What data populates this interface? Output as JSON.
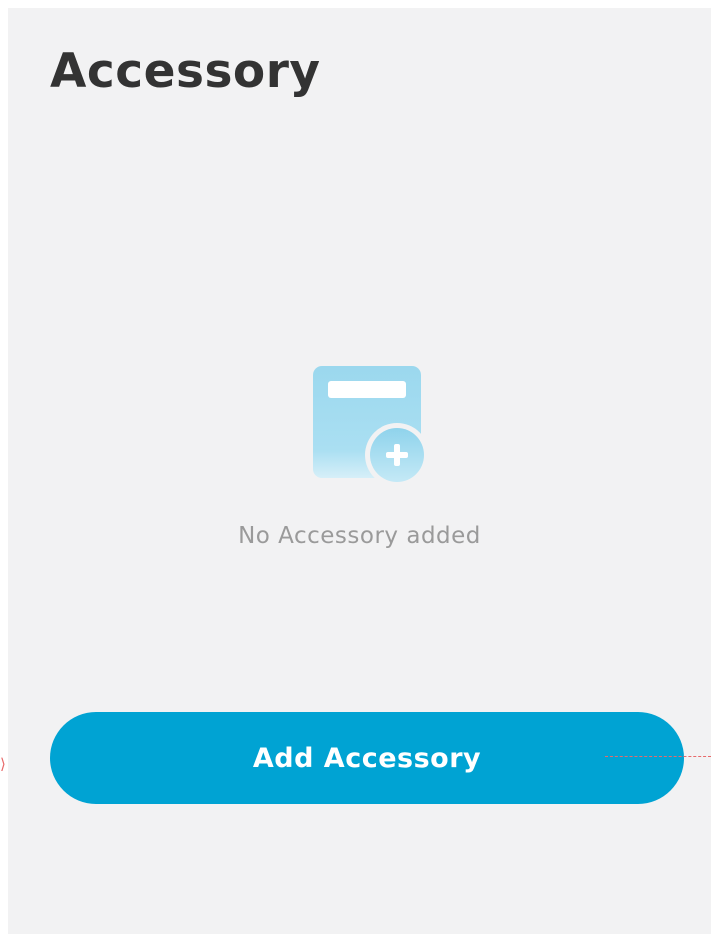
{
  "header": {
    "title": "Accessory"
  },
  "empty_state": {
    "icon": "add-accessory-icon",
    "message": "No Accessory added"
  },
  "actions": {
    "add_label": "Add Accessory"
  },
  "colors": {
    "background": "#f2f2f3",
    "accent": "#00a3d3",
    "icon_light": "#a8dcef",
    "text_primary": "#333333",
    "text_muted": "#9a9a9a",
    "guide": "#e86a6a"
  }
}
